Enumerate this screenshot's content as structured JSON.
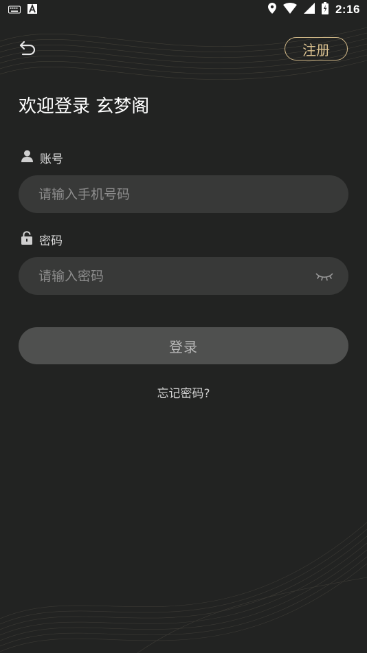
{
  "status_bar": {
    "time": "2:16",
    "icons_left": [
      "keyboard-icon",
      "text-a-icon"
    ],
    "icons_right": [
      "location-icon",
      "wifi-icon",
      "signal-icon",
      "battery-icon"
    ]
  },
  "header": {
    "back_icon": "back-arrow-icon",
    "register_label": "注册"
  },
  "title": "欢迎登录 玄梦阁",
  "account": {
    "label": "账号",
    "icon": "user-icon",
    "placeholder": "请输入手机号码",
    "value": ""
  },
  "password": {
    "label": "密码",
    "icon": "lock-icon",
    "placeholder": "请输入密码",
    "value": "",
    "toggle_icon": "eye-closed-icon"
  },
  "login_label": "登录",
  "forgot_label": "忘记密码?",
  "colors": {
    "background": "#222322",
    "accent_gold": "#d4bb8a",
    "input_bg": "#383938",
    "button_bg": "#4f504f"
  }
}
